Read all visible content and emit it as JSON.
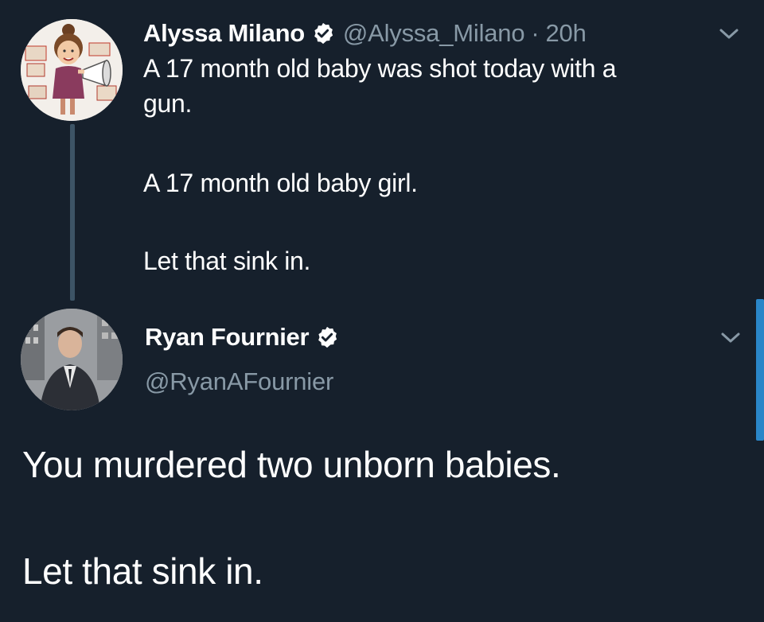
{
  "colors": {
    "background": "#16202c",
    "text_primary": "#ffffff",
    "text_secondary": "#8899a6",
    "thread_line": "#3d5466",
    "scrollbar": "#2a86c8"
  },
  "parent_tweet": {
    "author_name": "Alyssa Milano",
    "handle": "@Alyssa_Milano",
    "separator": "·",
    "time": "20h",
    "verified_icon": "verified-badge-icon",
    "menu_icon": "chevron-down-icon",
    "lines": [
      "A 17 month old baby was shot today with a",
      "gun.",
      "A 17 month old baby girl.",
      "Let that sink in."
    ]
  },
  "reply_tweet": {
    "author_name": "Ryan Fournier",
    "handle": "@RyanAFournier",
    "verified_icon": "verified-badge-icon",
    "menu_icon": "chevron-down-icon",
    "lines": [
      "You murdered two unborn babies.",
      "Let that sink in."
    ]
  }
}
